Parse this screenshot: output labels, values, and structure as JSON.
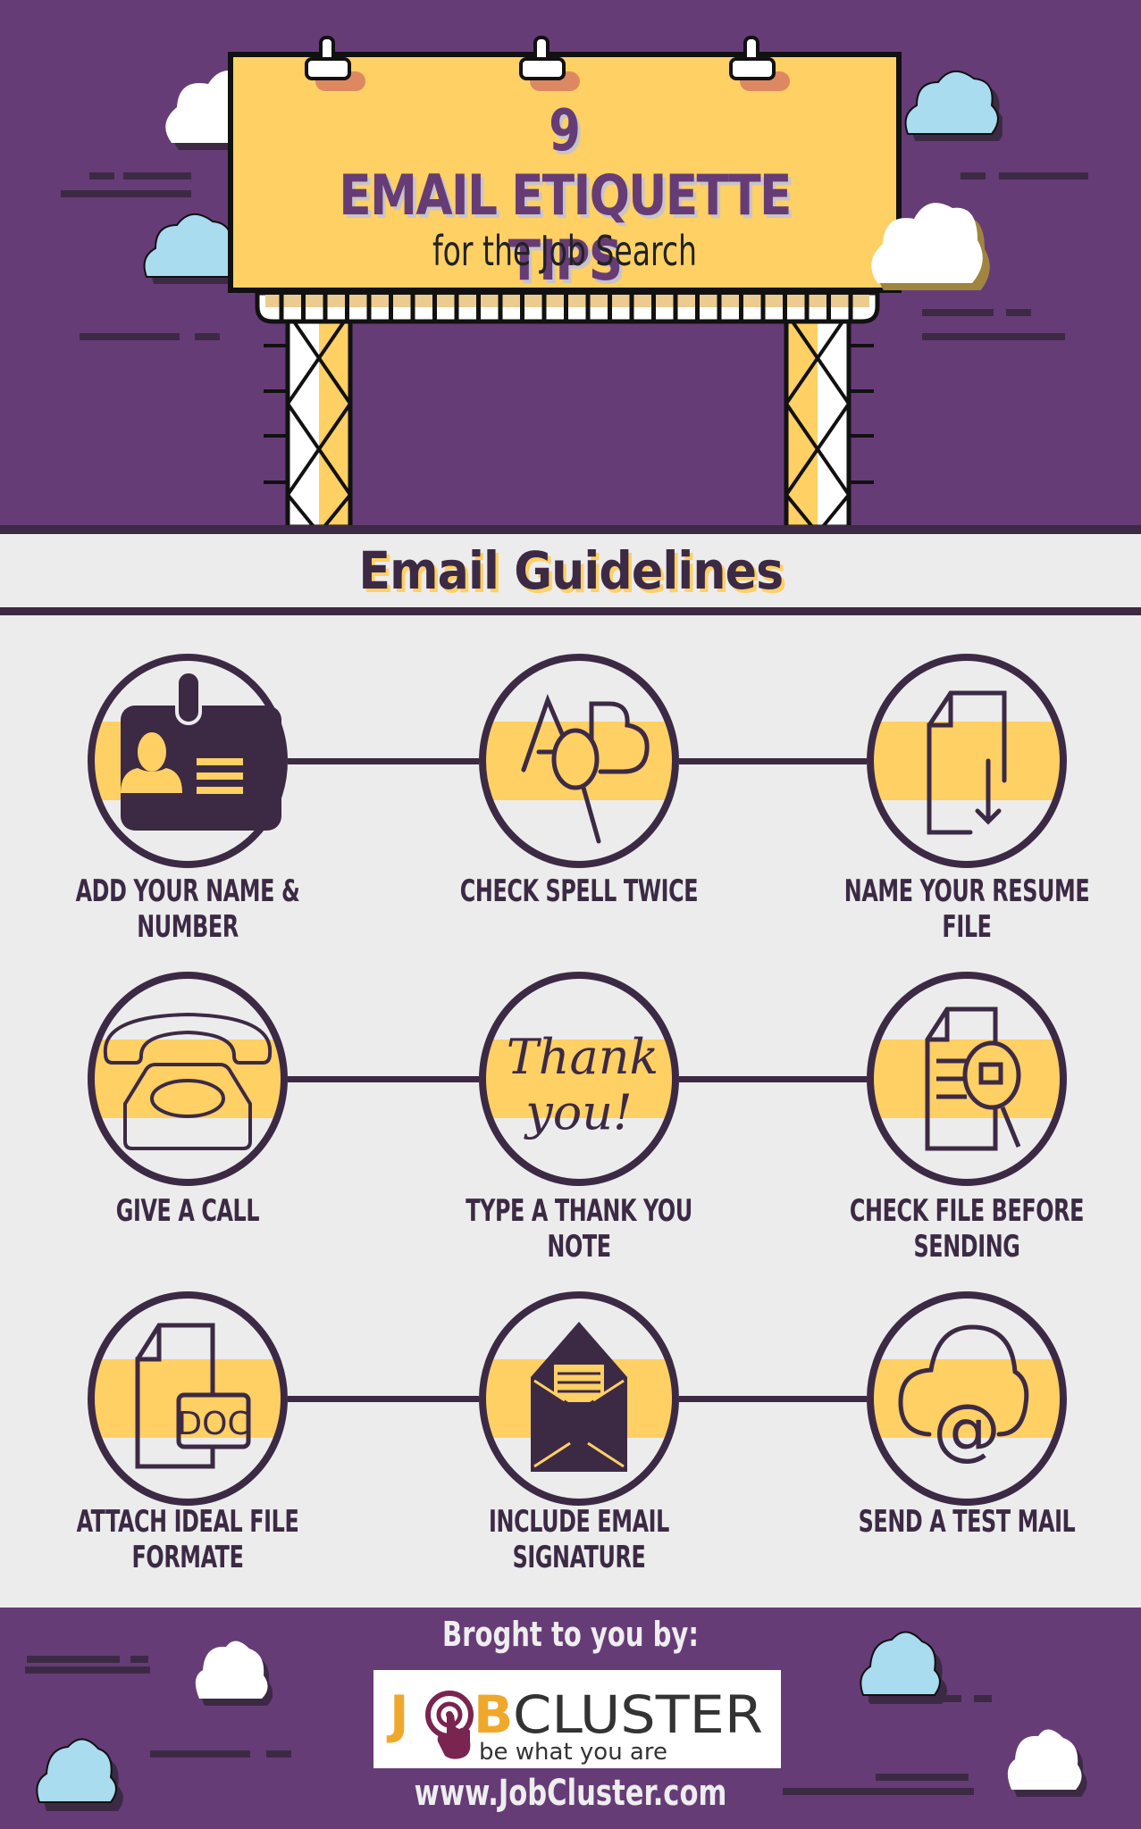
{
  "header": {
    "title_number": "9",
    "title_main": "EMAIL ETIQUETTE TIPS",
    "title_sub": "for the Job Search"
  },
  "section": {
    "title": "Email Guidelines"
  },
  "tips": [
    {
      "label": "ADD YOUR NAME & NUMBER",
      "icon": "id-card-icon"
    },
    {
      "label": "CHECK SPELL TWICE",
      "icon": "spell-check-magnifier-icon"
    },
    {
      "label": "NAME YOUR RESUME FILE",
      "icon": "file-download-icon"
    },
    {
      "label": "GIVE A CALL",
      "icon": "telephone-icon"
    },
    {
      "label": "TYPE A THANK YOU NOTE",
      "icon": "thank-you-note-icon",
      "icon_text_1": "Thank",
      "icon_text_2": "you!"
    },
    {
      "label": "CHECK FILE BEFORE SENDING",
      "icon": "file-inspect-icon"
    },
    {
      "label": "ATTACH IDEAL FILE FORMATE",
      "icon": "doc-file-icon",
      "icon_text": "DOC"
    },
    {
      "label": "INCLUDE EMAIL SIGNATURE",
      "icon": "open-envelope-icon"
    },
    {
      "label": "SEND A TEST MAIL",
      "icon": "cloud-at-icon",
      "icon_text": "@"
    }
  ],
  "footer": {
    "brought_by": "Broght to you by:",
    "logo": {
      "brand_left": "J",
      "brand_b": "B",
      "brand_right": "CLUSTER",
      "tagline": "be what you are"
    },
    "website": "www.JobCluster.com"
  },
  "colors": {
    "purple": "#663c77",
    "dark_purple": "#3c2a45",
    "yellow": "#ffd064",
    "light_gray": "#ececec",
    "sky_blue": "#a8dcee",
    "logo_orange": "#f0a82c",
    "logo_maroon": "#7a2450"
  }
}
